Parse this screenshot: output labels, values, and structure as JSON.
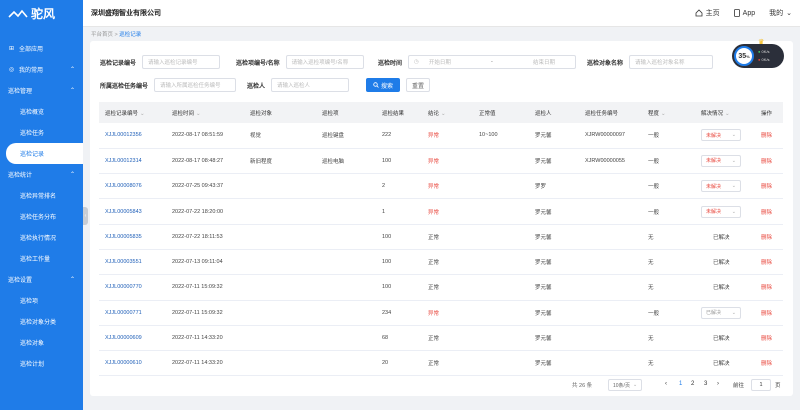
{
  "app": {
    "logo": "驼风",
    "company": "深圳盛翔智业有限公司"
  },
  "top_nav": {
    "home": "主页",
    "app": "App",
    "mine": "我的"
  },
  "sidebar": {
    "items": [
      {
        "label": "全部应用",
        "type": "top",
        "icon": "grid-icon"
      },
      {
        "label": "我的常用",
        "type": "top",
        "icon": "star-icon",
        "arrow": "⌃"
      },
      {
        "label": "巡检管理",
        "type": "group",
        "arrow": "⌃"
      },
      {
        "label": "巡检概览",
        "type": "sub"
      },
      {
        "label": "巡检任务",
        "type": "sub"
      },
      {
        "label": "巡检记录",
        "type": "active"
      },
      {
        "label": "巡检统计",
        "type": "group",
        "arrow": "⌃"
      },
      {
        "label": "巡检异常排名",
        "type": "sub"
      },
      {
        "label": "巡检任务分布",
        "type": "sub"
      },
      {
        "label": "巡检执行情况",
        "type": "sub"
      },
      {
        "label": "巡检工作量",
        "type": "sub"
      },
      {
        "label": "巡检设置",
        "type": "group",
        "arrow": "⌃"
      },
      {
        "label": "巡检项",
        "type": "sub"
      },
      {
        "label": "巡检对象分类",
        "type": "sub"
      },
      {
        "label": "巡检对象",
        "type": "sub"
      },
      {
        "label": "巡检计划",
        "type": "sub"
      }
    ]
  },
  "breadcrumb": {
    "home": "平台首页",
    "sep": ">",
    "current": "巡检记录"
  },
  "filters": {
    "record_no_label": "巡检记录编号",
    "record_no_placeholder": "请输入巡检记录编号",
    "item_label": "巡检项编号/名称",
    "item_placeholder": "请输入巡检项编号/名称",
    "time_label": "巡检时间",
    "start_placeholder": "开始日期",
    "range_sep": "-",
    "end_placeholder": "结束日期",
    "object_label": "巡检对象名称",
    "object_placeholder": "请输入巡检对象名称",
    "task_label": "所属巡检任务编号",
    "task_placeholder": "请输入所属巡检任务编号",
    "person_label": "巡检人",
    "person_placeholder": "请输入巡检人",
    "search_btn": "搜索",
    "reset_btn": "重置"
  },
  "gauge": {
    "value": "35",
    "unit": "%",
    "line1": "0K/s",
    "line2": "0K/s"
  },
  "table": {
    "headers": [
      "巡检记录编号",
      "巡检时间",
      "巡检对象",
      "巡检项",
      "巡检结果",
      "结论",
      "正常值",
      "巡检人",
      "巡检任务编号",
      "程度",
      "解决情况",
      "操作"
    ],
    "rows": [
      [
        "XJJL00012356",
        "2022-08-17 08:51:59",
        "视觉",
        "巡检键盘",
        "222",
        "异常",
        "10~100",
        "罗元馨",
        "XJRW00000097",
        "一般",
        "未解决",
        "删除"
      ],
      [
        "XJJL00012314",
        "2022-08-17 08:48:27",
        "新旧程度",
        "巡检电脑",
        "100",
        "异常",
        "",
        "罗元馨",
        "XJRW00000055",
        "一般",
        "未解决",
        "删除"
      ],
      [
        "XJJL00008076",
        "2022-07-25 09:43:37",
        "",
        "",
        "2",
        "异常",
        "",
        "罗罗",
        "",
        "一般",
        "未解决",
        "删除"
      ],
      [
        "XJJL00005843",
        "2022-07-22 18:20:00",
        "",
        "",
        "1",
        "异常",
        "",
        "罗元馨",
        "",
        "一般",
        "未解决",
        "删除"
      ],
      [
        "XJJL00005835",
        "2022-07-22 18:11:53",
        "",
        "",
        "100",
        "正常",
        "",
        "罗元馨",
        "",
        "无",
        "已解决",
        "删除"
      ],
      [
        "XJJL00003551",
        "2022-07-13 09:11:04",
        "",
        "",
        "100",
        "正常",
        "",
        "罗元馨",
        "",
        "无",
        "已解决",
        "删除"
      ],
      [
        "XJJL00000770",
        "2022-07-11 15:09:32",
        "",
        "",
        "100",
        "正常",
        "",
        "罗元馨",
        "",
        "无",
        "已解决",
        "删除"
      ],
      [
        "XJJL00000771",
        "2022-07-11 15:09:32",
        "",
        "",
        "234",
        "异常",
        "",
        "罗元馨",
        "",
        "一般",
        "已解决",
        "删除"
      ],
      [
        "XJJL00000609",
        "2022-07-11 14:33:20",
        "",
        "",
        "68",
        "正常",
        "",
        "罗元馨",
        "",
        "无",
        "已解决",
        "删除"
      ],
      [
        "XJJL00000610",
        "2022-07-11 14:33:20",
        "",
        "",
        "20",
        "正常",
        "",
        "罗元馨",
        "",
        "无",
        "已解决",
        "删除"
      ]
    ]
  },
  "pagination": {
    "total": "共 26 条",
    "page_size": "10条/页",
    "pages": [
      "1",
      "2",
      "3"
    ],
    "prev": "‹",
    "next": "›",
    "goto": "前往",
    "current": "1",
    "suffix": "页"
  },
  "colors": {
    "primary": "#1f7ce8",
    "danger": "#e8463c"
  }
}
